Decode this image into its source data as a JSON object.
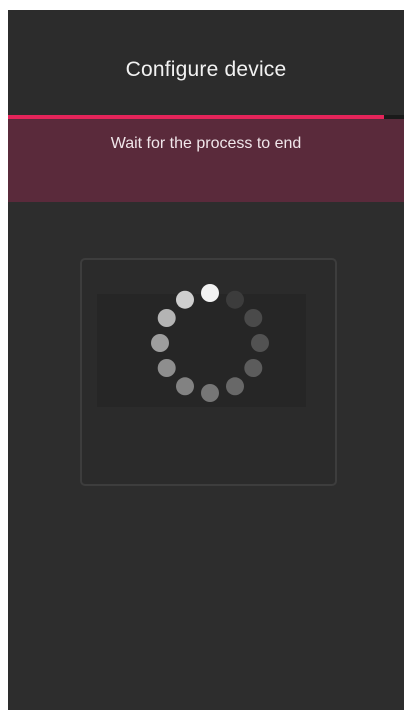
{
  "app": {
    "title": "Configure device"
  },
  "progress": {
    "value": 0.95,
    "color": "#e5245a"
  },
  "banner": {
    "message": "Wait for the process to end",
    "color": "#5a2a3b"
  },
  "spinner": {
    "icon": "loading-spinner-icon",
    "dots": 12
  }
}
